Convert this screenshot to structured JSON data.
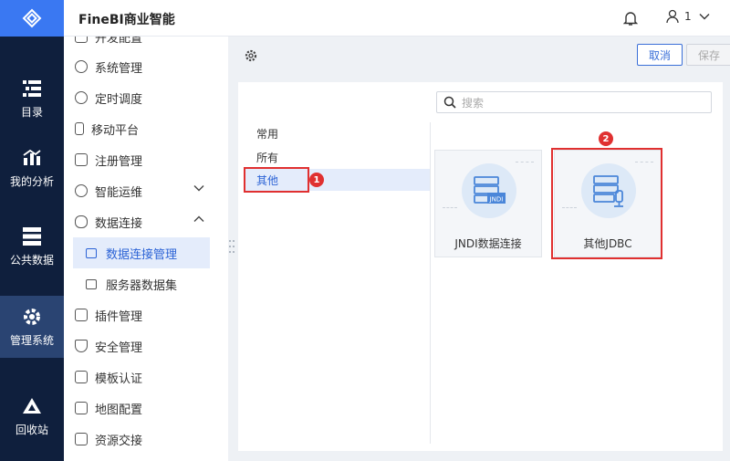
{
  "app": {
    "title": "FineBI商业智能"
  },
  "user": {
    "name": "1"
  },
  "nav": {
    "items": [
      {
        "label": "目录",
        "icon": "catalog-icon"
      },
      {
        "label": "我的分析",
        "icon": "analysis-icon"
      },
      {
        "label": "公共数据",
        "icon": "public-data-icon"
      },
      {
        "label": "管理系统",
        "icon": "management-icon"
      },
      {
        "label": "回收站",
        "icon": "recycle-bin-icon"
      }
    ]
  },
  "submenu": {
    "items": [
      {
        "label": "开发配置"
      },
      {
        "label": "系统管理"
      },
      {
        "label": "定时调度"
      },
      {
        "label": "移动平台"
      },
      {
        "label": "注册管理"
      },
      {
        "label": "智能运维"
      },
      {
        "label": "数据连接"
      },
      {
        "label": "插件管理"
      },
      {
        "label": "安全管理"
      },
      {
        "label": "模板认证"
      },
      {
        "label": "地图配置"
      },
      {
        "label": "资源交接"
      }
    ],
    "children": [
      {
        "label": "数据连接管理"
      },
      {
        "label": "服务器数据集"
      }
    ]
  },
  "toolbar": {
    "cancel_label": "取消",
    "save_label": "保存"
  },
  "search": {
    "placeholder": "搜索"
  },
  "categories": [
    {
      "label": "常用"
    },
    {
      "label": "所有"
    },
    {
      "label": "其他"
    }
  ],
  "cards": [
    {
      "label": "JNDI数据连接",
      "icon_text": "JNDI"
    },
    {
      "label": "其他JDBC"
    }
  ],
  "badges": {
    "one": "1",
    "two": "2"
  },
  "colors": {
    "accent": "#3a78f2",
    "nav_bg": "#0f1f3d",
    "highlight": "#e03030"
  }
}
